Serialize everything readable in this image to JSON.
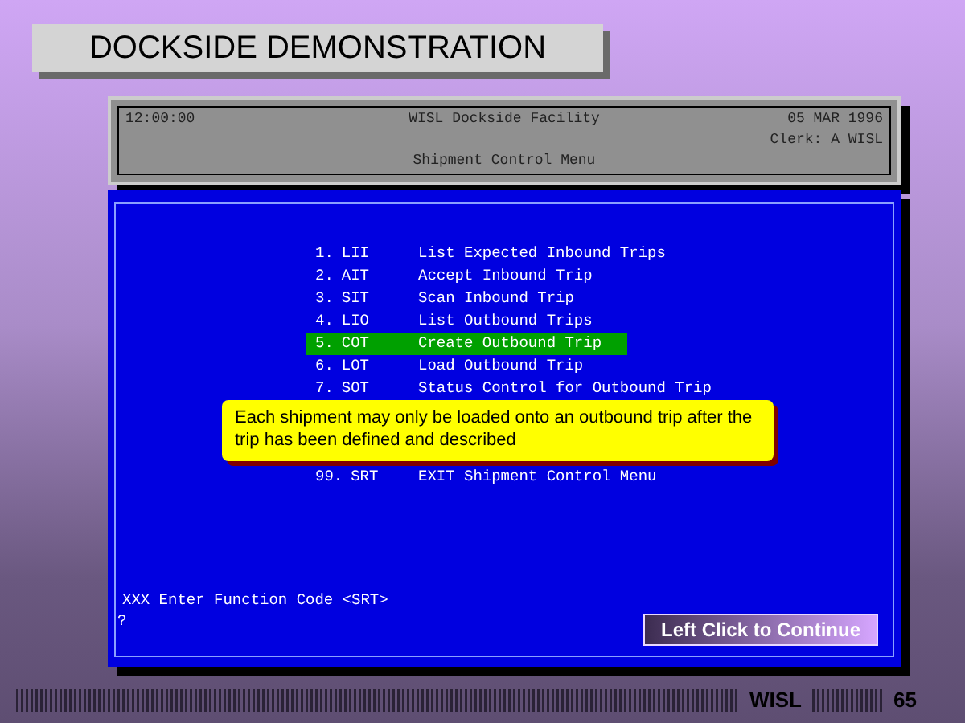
{
  "title": "DOCKSIDE DEMONSTRATION",
  "header": {
    "time": "12:00:00",
    "facility": "WISL Dockside Facility",
    "date": "05 MAR 1996",
    "clerk": "Clerk: A WISL",
    "menu_title": "Shipment Control Menu"
  },
  "menu_items": [
    {
      "number": "1.",
      "code": "LII",
      "label": "List Expected Inbound Trips",
      "selected": false
    },
    {
      "number": "2.",
      "code": "AIT",
      "label": "Accept Inbound Trip",
      "selected": false
    },
    {
      "number": "3.",
      "code": "SIT",
      "label": "Scan Inbound Trip",
      "selected": false
    },
    {
      "number": "4.",
      "code": "LIO",
      "label": "List Outbound Trips",
      "selected": false
    },
    {
      "number": "5.",
      "code": "COT",
      "label": "Create Outbound Trip",
      "selected": true
    },
    {
      "number": "6.",
      "code": "LOT",
      "label": "Load Outbound Trip",
      "selected": false
    },
    {
      "number": "7.",
      "code": "SOT",
      "label": "Status Control for Outbound Trip",
      "selected": false
    },
    {
      "number": "99.",
      "code": "SRT",
      "label": "EXIT Shipment Control Menu",
      "selected": false
    }
  ],
  "callout": "Each shipment may only be loaded onto an outbound trip after the trip has been defined and described",
  "prompt": "XXX Enter Function Code <SRT>",
  "cursor": "?",
  "continue_button": "Left Click to Continue",
  "footer": {
    "brand": "WISL",
    "page": "65"
  }
}
